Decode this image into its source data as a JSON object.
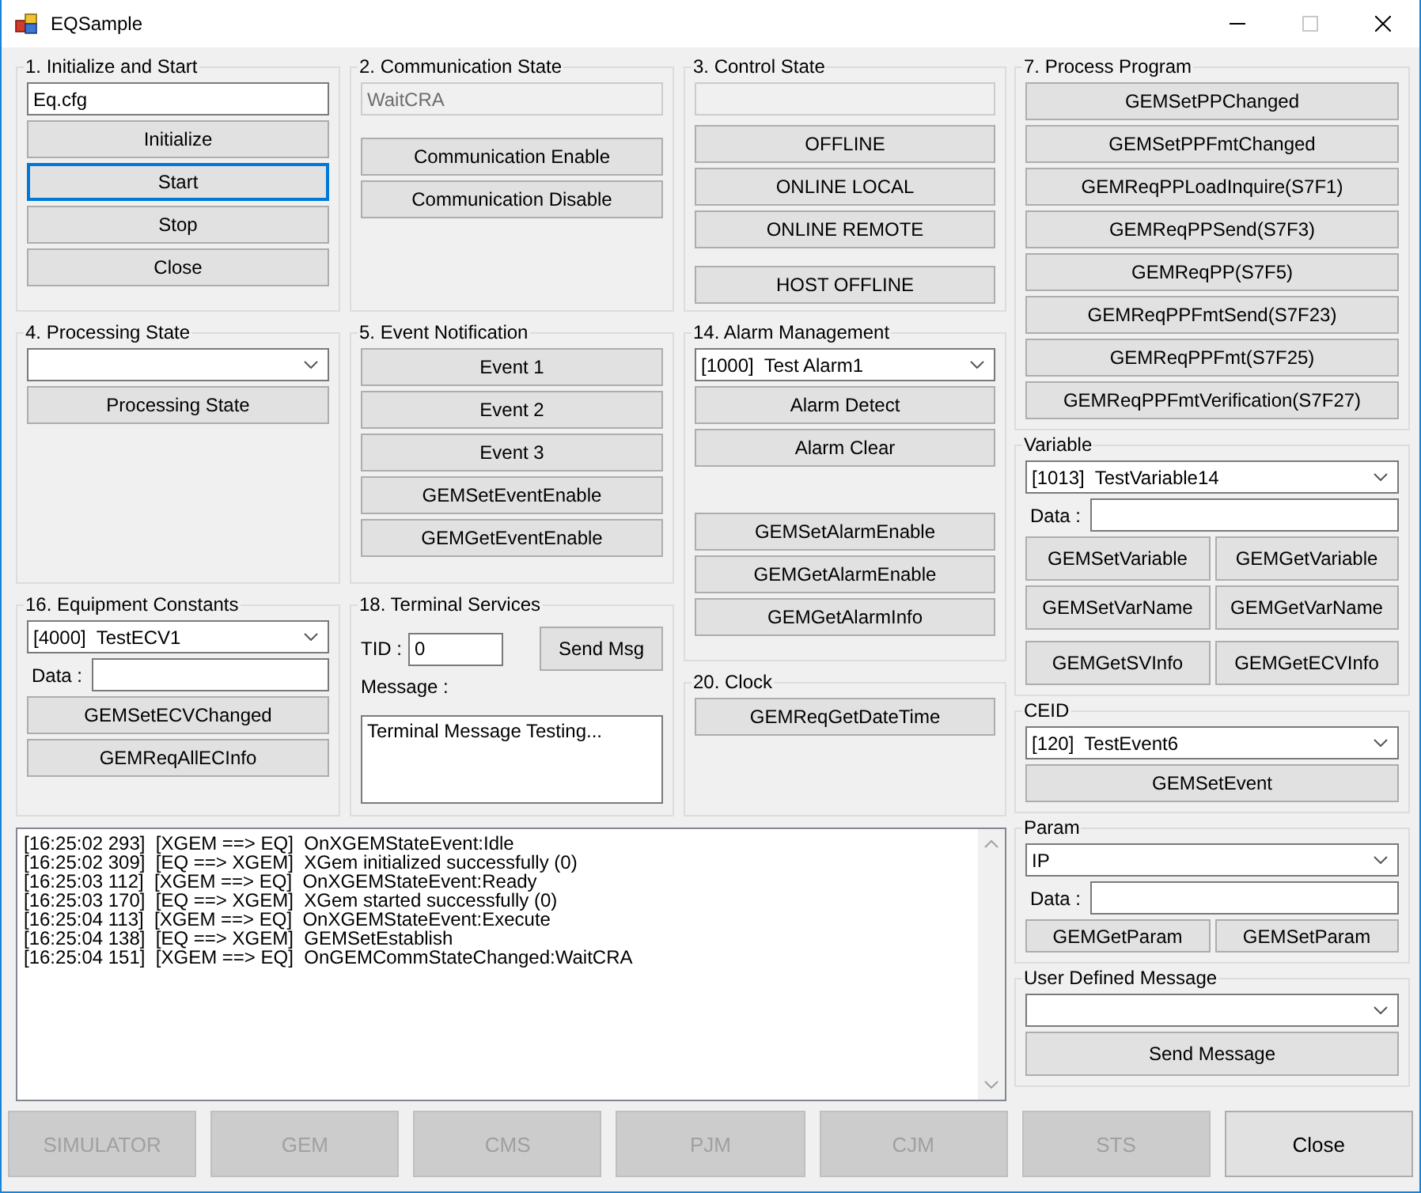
{
  "window": {
    "title": "EQSample"
  },
  "left_groups": [
    {
      "title": "1. Initialize and Start",
      "items": [
        {
          "kind": "field",
          "value": "Eq.cfg",
          "disabled": false
        },
        {
          "kind": "button",
          "label": "Initialize"
        },
        {
          "kind": "button",
          "label": "Start",
          "focused": true
        },
        {
          "kind": "button",
          "label": "Stop"
        },
        {
          "kind": "button",
          "label": "Close"
        }
      ]
    },
    {
      "title": "2. Communication State",
      "items": [
        {
          "kind": "field",
          "value": "WaitCRA",
          "disabled": true
        },
        {
          "kind": "gap"
        },
        {
          "kind": "button",
          "label": "Communication Enable"
        },
        {
          "kind": "button",
          "label": "Communication Disable"
        }
      ]
    },
    {
      "title": "3. Control State",
      "items": [
        {
          "kind": "field",
          "disabled": true
        },
        {
          "kind": "button",
          "label": "OFFLINE"
        },
        {
          "kind": "button",
          "label": "ONLINE LOCAL"
        },
        {
          "kind": "button",
          "label": "ONLINE REMOTE"
        },
        {
          "kind": "gap"
        },
        {
          "kind": "button",
          "label": "HOST OFFLINE"
        }
      ]
    },
    {
      "title": "4. Processing State",
      "items": [
        {
          "kind": "dropdown"
        },
        {
          "kind": "button",
          "label": "Processing State"
        }
      ]
    },
    {
      "title": "5. Event Notification",
      "items": [
        {
          "kind": "button",
          "label": "Event 1"
        },
        {
          "kind": "button",
          "label": "Event 2"
        },
        {
          "kind": "button",
          "label": "Event 3"
        },
        {
          "kind": "button",
          "label": "GEMSetEventEnable"
        },
        {
          "kind": "button",
          "label": "GEMGetEventEnable"
        }
      ]
    },
    {
      "title": "14. Alarm Management",
      "items": [
        {
          "kind": "dropdown",
          "value": "[1000]  Test Alarm1"
        },
        {
          "kind": "button",
          "label": "Alarm Detect"
        },
        {
          "kind": "button",
          "label": "Alarm Clear"
        },
        {
          "kind": "gap"
        },
        {
          "kind": "gap"
        },
        {
          "kind": "button",
          "label": "GEMSetAlarmEnable"
        },
        {
          "kind": "button",
          "label": "GEMGetAlarmEnable"
        },
        {
          "kind": "button",
          "label": "GEMGetAlarmInfo"
        }
      ]
    },
    {
      "title": "16. Equipment Constants",
      "items": [
        {
          "kind": "dropdown",
          "value": "[4000]  TestECV1"
        },
        {
          "kind": "labeled-field",
          "label": "Data :"
        },
        {
          "kind": "button",
          "label": "GEMSetECVChanged"
        },
        {
          "kind": "button",
          "label": "GEMReqAllECInfo"
        }
      ]
    },
    {
      "title": "18. Terminal Services",
      "items": [
        {
          "kind": "tid-row",
          "label": "TID :",
          "value": "0",
          "button": "Send Msg"
        },
        {
          "kind": "label",
          "label": "Message :"
        },
        {
          "kind": "textarea",
          "value": "Terminal Message Testing..."
        }
      ]
    },
    {
      "title": "20. Clock",
      "items": [
        {
          "kind": "button",
          "label": "GEMReqGetDateTime"
        }
      ]
    }
  ],
  "right_groups": [
    {
      "title": "7. Process Program",
      "items": [
        {
          "kind": "button",
          "label": "GEMSetPPChanged"
        },
        {
          "kind": "button",
          "label": "GEMSetPPFmtChanged"
        },
        {
          "kind": "button",
          "label": "GEMReqPPLoadInquire(S7F1)"
        },
        {
          "kind": "button",
          "label": "GEMReqPPSend(S7F3)"
        },
        {
          "kind": "button",
          "label": "GEMReqPP(S7F5)"
        },
        {
          "kind": "button",
          "label": "GEMReqPPFmtSend(S7F23)"
        },
        {
          "kind": "button",
          "label": "GEMReqPPFmt(S7F25)"
        },
        {
          "kind": "button",
          "label": "GEMReqPPFmtVerification(S7F27)"
        }
      ]
    },
    {
      "title": "Variable",
      "items": [
        {
          "kind": "dropdown",
          "value": "[1013]  TestVariable14"
        },
        {
          "kind": "labeled-field",
          "label": "Data :"
        },
        {
          "kind": "button-row",
          "buttons": [
            "GEMSetVariable",
            "GEMGetVariable"
          ]
        },
        {
          "kind": "button-row",
          "buttons": [
            "GEMSetVarName",
            "GEMGetVarName"
          ]
        },
        {
          "kind": "button-row",
          "buttons": [
            "GEMGetSVInfo",
            "GEMGetECVInfo"
          ]
        }
      ]
    },
    {
      "title": "CEID",
      "items": [
        {
          "kind": "dropdown",
          "value": "[120]  TestEvent6"
        },
        {
          "kind": "button",
          "label": "GEMSetEvent"
        }
      ]
    },
    {
      "title": "Param",
      "items": [
        {
          "kind": "dropdown",
          "value": "IP"
        },
        {
          "kind": "labeled-field",
          "label": "Data :"
        },
        {
          "kind": "button-row",
          "buttons": [
            "GEMGetParam",
            "GEMSetParam"
          ]
        }
      ]
    },
    {
      "title": "User Defined Message",
      "items": [
        {
          "kind": "dropdown"
        },
        {
          "kind": "button",
          "label": "Send Message"
        }
      ]
    }
  ],
  "log": [
    "[16:25:02 293]  [XGEM ==> EQ]  OnXGEMStateEvent:Idle",
    "[16:25:02 309]  [EQ ==> XGEM]  XGem initialized successfully (0)",
    "[16:25:03 112]  [XGEM ==> EQ]  OnXGEMStateEvent:Ready",
    "[16:25:03 170]  [EQ ==> XGEM]  XGem started successfully (0)",
    "[16:25:04 113]  [XGEM ==> EQ]  OnXGEMStateEvent:Execute",
    "[16:25:04 138]  [EQ ==> XGEM]  GEMSetEstablish",
    "[16:25:04 151]  [XGEM ==> EQ]  OnGEMCommStateChanged:WaitCRA"
  ],
  "bottom_buttons": [
    {
      "label": "SIMULATOR",
      "disabled": true
    },
    {
      "label": "GEM",
      "disabled": true
    },
    {
      "label": "CMS",
      "disabled": true
    },
    {
      "label": "PJM",
      "disabled": true
    },
    {
      "label": "CJM",
      "disabled": true
    },
    {
      "label": "STS",
      "disabled": true
    },
    {
      "label": "Close",
      "disabled": false
    }
  ]
}
